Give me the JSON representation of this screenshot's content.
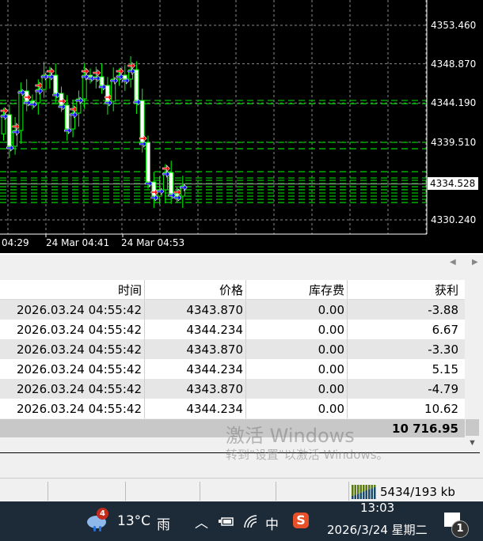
{
  "chart": {
    "price_labels": [
      {
        "label": "4353.460",
        "price": 4353.46
      },
      {
        "label": "4348.870",
        "price": 4348.87
      },
      {
        "label": "4344.190",
        "price": 4344.19
      },
      {
        "label": "4339.510",
        "price": 4339.51
      },
      {
        "label": "4330.240",
        "price": 4330.24
      }
    ],
    "current_price": "4334.528",
    "time_labels": [
      "04:29",
      "24 Mar 04:41",
      "24 Mar 04:53"
    ],
    "colors": {
      "candle": "#00ff00",
      "grid": "#8a8a8a",
      "level": "#00c000",
      "buy_arrow": "#0000ff",
      "sell_arrow": "#ff0000"
    },
    "closes": [
      4342.79,
      4339.02,
      4340.91,
      4345.63,
      4344.4,
      4344.21,
      4345.81,
      4347.51,
      4347.51,
      4345.34,
      4343.93,
      4341.09,
      4342.98,
      4344.68,
      4347.51,
      4347.32,
      4347.32,
      4346.29,
      4344.4,
      4347.04,
      4347.51,
      4347.04,
      4348.17,
      4344.49,
      4339.49,
      4334.77,
      4333.07,
      4333.83,
      4335.9,
      4333.35,
      4333.07,
      4334.3
    ],
    "levels": [
      4344.49,
      4344.11,
      4339.49,
      4338.73,
      4335.99,
      4335.24,
      4334.96,
      4334.58,
      4334.2,
      4333.83,
      4333.45,
      4333.07,
      4332.69,
      4332.31
    ]
  },
  "table": {
    "headers": [
      "时间",
      "价格",
      "库存费",
      "获利"
    ],
    "rows": [
      [
        "2026.03.24 04:55:42",
        "4343.870",
        "0.00",
        "-3.88"
      ],
      [
        "2026.03.24 04:55:42",
        "4344.234",
        "0.00",
        "6.67"
      ],
      [
        "2026.03.24 04:55:42",
        "4343.870",
        "0.00",
        "-3.30"
      ],
      [
        "2026.03.24 04:55:42",
        "4344.234",
        "0.00",
        "5.15"
      ],
      [
        "2026.03.24 04:55:42",
        "4343.870",
        "0.00",
        "-4.79"
      ],
      [
        "2026.03.24 04:55:42",
        "4344.234",
        "0.00",
        "10.62"
      ]
    ],
    "total": "10 716.95"
  },
  "watermark": {
    "line1": "激活 Windows",
    "line2": "转到\"设置\"以激活 Windows。"
  },
  "status": {
    "traffic": "5434/193 kb"
  },
  "taskbar": {
    "weather_badge": "4",
    "temperature": "13°C",
    "weather": "雨",
    "ime": "中",
    "time": "13:03",
    "date": "2026/3/24 星期二",
    "notifications": "1"
  }
}
